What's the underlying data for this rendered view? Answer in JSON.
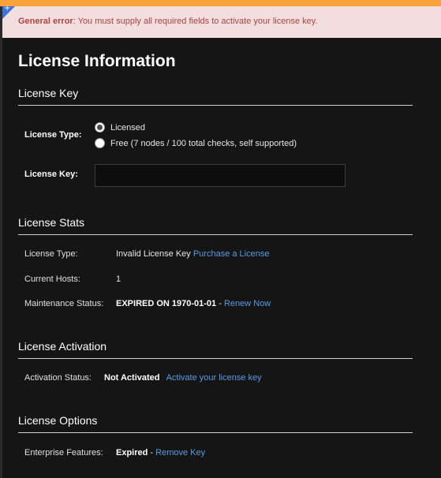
{
  "alert": {
    "prefix": "General error",
    "message": ": You must supply all required fields to activate your license key."
  },
  "page_title": "License Information",
  "license_key_section": {
    "title": "License Key",
    "type_label": "License Type:",
    "options": [
      {
        "label": "Licensed",
        "checked": true
      },
      {
        "label": "Free (7 nodes / 100 total checks, self supported)",
        "checked": false
      }
    ],
    "key_label": "License Key:",
    "key_value": ""
  },
  "stats_section": {
    "title": "License Stats",
    "license_type_label": "License Type:",
    "license_type_value": "Invalid License Key",
    "purchase_link": "Purchase a License",
    "hosts_label": "Current Hosts:",
    "hosts_value": "1",
    "maintenance_label": "Maintenance Status:",
    "maintenance_value": "EXPIRED ON 1970-01-01",
    "separator": " - ",
    "renew_link": "Renew Now"
  },
  "activation_section": {
    "title": "License Activation",
    "status_label": "Activation Status:",
    "status_value": "Not Activated",
    "activate_link": "Activate your license key"
  },
  "options_section": {
    "title": "License Options",
    "enterprise_label": "Enterprise Features:",
    "enterprise_value": "Expired",
    "separator": " - ",
    "remove_link": "Remove Key"
  },
  "colors": {
    "top_bar": "#f7a23a",
    "alert_bg": "#f2dede",
    "alert_text": "#a94442",
    "link": "#5b9be6",
    "corner": "#3d75d6"
  },
  "corner_icon": "plus-icon"
}
